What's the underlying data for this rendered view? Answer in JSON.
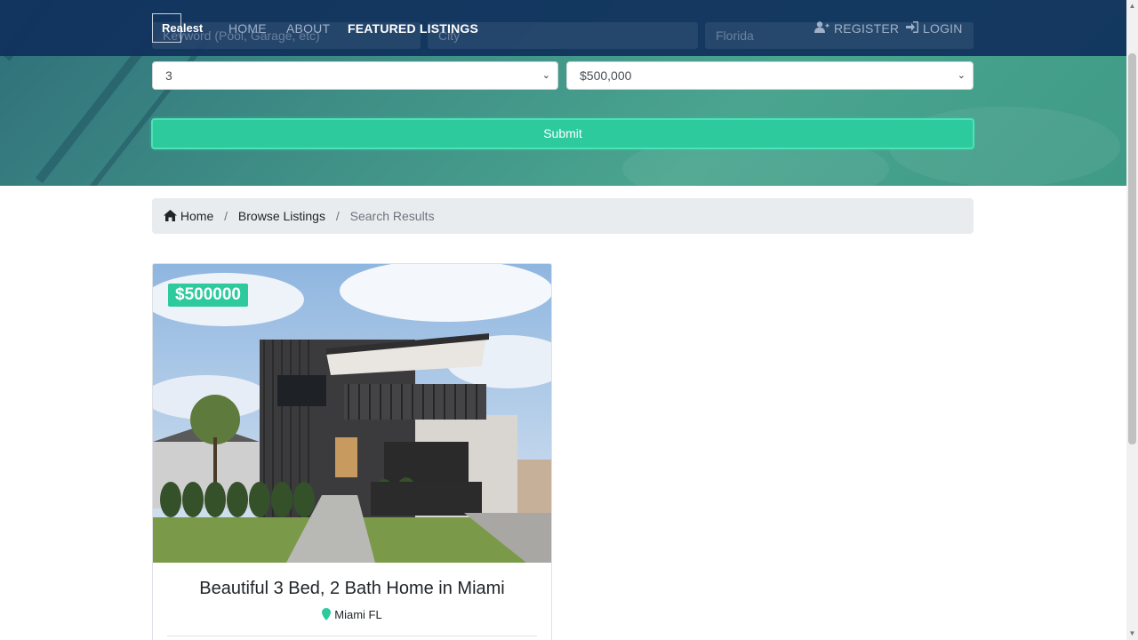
{
  "navbar": {
    "brand": "Realest",
    "links": [
      {
        "label": "HOME"
      },
      {
        "label": "ABOUT"
      },
      {
        "label": "FEATURED LISTINGS"
      }
    ],
    "register_label": "REGISTER",
    "login_label": "LOGIN"
  },
  "search": {
    "keywords_placeholder": "Keyword (Pool, Garage, etc)",
    "city_placeholder": "City",
    "state_value": "Florida",
    "bedrooms_value": "3",
    "price_value": "$500,000",
    "submit_label": "Submit"
  },
  "breadcrumb": {
    "home": "Home",
    "browse": "Browse Listings",
    "current": "Search Results"
  },
  "listing": {
    "price": "$500000",
    "title": "Beautiful 3 Bed, 2 Bath Home in Miami",
    "location": "Miami FL"
  },
  "colors": {
    "navbar": "#10305c",
    "accent": "#2dca9e"
  }
}
